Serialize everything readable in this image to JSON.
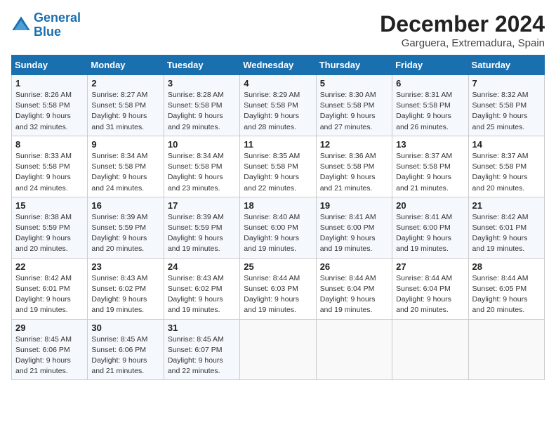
{
  "header": {
    "logo_line1": "General",
    "logo_line2": "Blue",
    "month": "December 2024",
    "location": "Garguera, Extremadura, Spain"
  },
  "weekdays": [
    "Sunday",
    "Monday",
    "Tuesday",
    "Wednesday",
    "Thursday",
    "Friday",
    "Saturday"
  ],
  "weeks": [
    [
      {
        "day": "1",
        "info": "Sunrise: 8:26 AM\nSunset: 5:58 PM\nDaylight: 9 hours\nand 32 minutes."
      },
      {
        "day": "2",
        "info": "Sunrise: 8:27 AM\nSunset: 5:58 PM\nDaylight: 9 hours\nand 31 minutes."
      },
      {
        "day": "3",
        "info": "Sunrise: 8:28 AM\nSunset: 5:58 PM\nDaylight: 9 hours\nand 29 minutes."
      },
      {
        "day": "4",
        "info": "Sunrise: 8:29 AM\nSunset: 5:58 PM\nDaylight: 9 hours\nand 28 minutes."
      },
      {
        "day": "5",
        "info": "Sunrise: 8:30 AM\nSunset: 5:58 PM\nDaylight: 9 hours\nand 27 minutes."
      },
      {
        "day": "6",
        "info": "Sunrise: 8:31 AM\nSunset: 5:58 PM\nDaylight: 9 hours\nand 26 minutes."
      },
      {
        "day": "7",
        "info": "Sunrise: 8:32 AM\nSunset: 5:58 PM\nDaylight: 9 hours\nand 25 minutes."
      }
    ],
    [
      {
        "day": "8",
        "info": "Sunrise: 8:33 AM\nSunset: 5:58 PM\nDaylight: 9 hours\nand 24 minutes."
      },
      {
        "day": "9",
        "info": "Sunrise: 8:34 AM\nSunset: 5:58 PM\nDaylight: 9 hours\nand 24 minutes."
      },
      {
        "day": "10",
        "info": "Sunrise: 8:34 AM\nSunset: 5:58 PM\nDaylight: 9 hours\nand 23 minutes."
      },
      {
        "day": "11",
        "info": "Sunrise: 8:35 AM\nSunset: 5:58 PM\nDaylight: 9 hours\nand 22 minutes."
      },
      {
        "day": "12",
        "info": "Sunrise: 8:36 AM\nSunset: 5:58 PM\nDaylight: 9 hours\nand 21 minutes."
      },
      {
        "day": "13",
        "info": "Sunrise: 8:37 AM\nSunset: 5:58 PM\nDaylight: 9 hours\nand 21 minutes."
      },
      {
        "day": "14",
        "info": "Sunrise: 8:37 AM\nSunset: 5:58 PM\nDaylight: 9 hours\nand 20 minutes."
      }
    ],
    [
      {
        "day": "15",
        "info": "Sunrise: 8:38 AM\nSunset: 5:59 PM\nDaylight: 9 hours\nand 20 minutes."
      },
      {
        "day": "16",
        "info": "Sunrise: 8:39 AM\nSunset: 5:59 PM\nDaylight: 9 hours\nand 20 minutes."
      },
      {
        "day": "17",
        "info": "Sunrise: 8:39 AM\nSunset: 5:59 PM\nDaylight: 9 hours\nand 19 minutes."
      },
      {
        "day": "18",
        "info": "Sunrise: 8:40 AM\nSunset: 6:00 PM\nDaylight: 9 hours\nand 19 minutes."
      },
      {
        "day": "19",
        "info": "Sunrise: 8:41 AM\nSunset: 6:00 PM\nDaylight: 9 hours\nand 19 minutes."
      },
      {
        "day": "20",
        "info": "Sunrise: 8:41 AM\nSunset: 6:00 PM\nDaylight: 9 hours\nand 19 minutes."
      },
      {
        "day": "21",
        "info": "Sunrise: 8:42 AM\nSunset: 6:01 PM\nDaylight: 9 hours\nand 19 minutes."
      }
    ],
    [
      {
        "day": "22",
        "info": "Sunrise: 8:42 AM\nSunset: 6:01 PM\nDaylight: 9 hours\nand 19 minutes."
      },
      {
        "day": "23",
        "info": "Sunrise: 8:43 AM\nSunset: 6:02 PM\nDaylight: 9 hours\nand 19 minutes."
      },
      {
        "day": "24",
        "info": "Sunrise: 8:43 AM\nSunset: 6:02 PM\nDaylight: 9 hours\nand 19 minutes."
      },
      {
        "day": "25",
        "info": "Sunrise: 8:44 AM\nSunset: 6:03 PM\nDaylight: 9 hours\nand 19 minutes."
      },
      {
        "day": "26",
        "info": "Sunrise: 8:44 AM\nSunset: 6:04 PM\nDaylight: 9 hours\nand 19 minutes."
      },
      {
        "day": "27",
        "info": "Sunrise: 8:44 AM\nSunset: 6:04 PM\nDaylight: 9 hours\nand 20 minutes."
      },
      {
        "day": "28",
        "info": "Sunrise: 8:44 AM\nSunset: 6:05 PM\nDaylight: 9 hours\nand 20 minutes."
      }
    ],
    [
      {
        "day": "29",
        "info": "Sunrise: 8:45 AM\nSunset: 6:06 PM\nDaylight: 9 hours\nand 21 minutes."
      },
      {
        "day": "30",
        "info": "Sunrise: 8:45 AM\nSunset: 6:06 PM\nDaylight: 9 hours\nand 21 minutes."
      },
      {
        "day": "31",
        "info": "Sunrise: 8:45 AM\nSunset: 6:07 PM\nDaylight: 9 hours\nand 22 minutes."
      },
      {
        "day": "",
        "info": ""
      },
      {
        "day": "",
        "info": ""
      },
      {
        "day": "",
        "info": ""
      },
      {
        "day": "",
        "info": ""
      }
    ]
  ]
}
